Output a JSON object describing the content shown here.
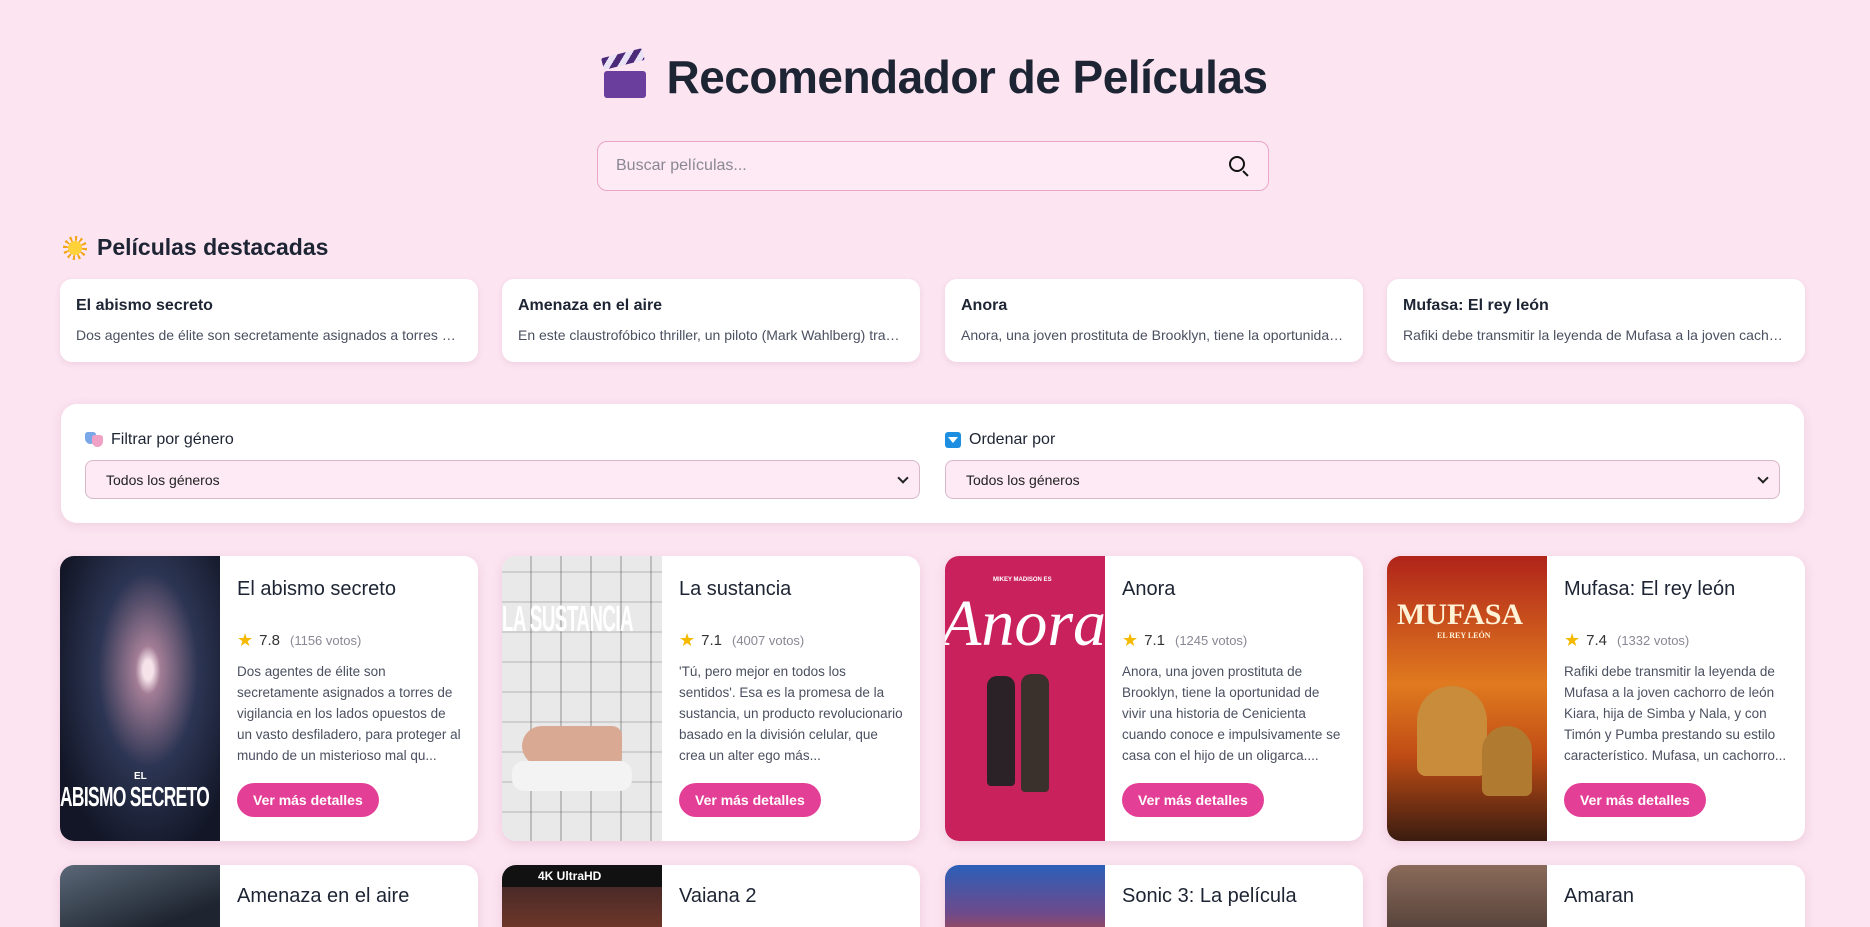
{
  "header": {
    "icon": "clapperboard-icon",
    "title": "Recomendador de Películas"
  },
  "search": {
    "placeholder": "Buscar películas...",
    "icon": "search-icon"
  },
  "featured": {
    "title": "Películas destacadas",
    "icon": "sun-icon",
    "items": [
      {
        "title": "El abismo secreto",
        "desc": "Dos agentes de élite son secretamente asignados a torres de vigilancia en los lados opuestos de un vasto desfiladero..."
      },
      {
        "title": "Amenaza en el aire",
        "desc": "En este claustrofóbico thriller, un piloto (Mark Wahlberg) transporta a una testigo..."
      },
      {
        "title": "Anora",
        "desc": "Anora, una joven prostituta de Brooklyn, tiene la oportunidad de vivir una historia de Cenicienta..."
      },
      {
        "title": "Mufasa: El rey león",
        "desc": "Rafiki debe transmitir la leyenda de Mufasa a la joven cachorro de león Kiara..."
      }
    ]
  },
  "filters": {
    "genre_label": "Filtrar por género",
    "genre_value": "Todos los géneros",
    "sort_label": "Ordenar por",
    "sort_value": "Todos los géneros"
  },
  "movies": [
    {
      "title": "El abismo secreto",
      "rating": "7.8",
      "votes": "(1156 votos)",
      "overview": "Dos agentes de élite son secretamente asignados a torres de vigilancia en los lados opuestos de un vasto desfiladero, para proteger al mundo de un misterioso mal qu...",
      "button": "Ver más detalles",
      "poster_text": "ABISMO SECRETO",
      "poster_small": "EL"
    },
    {
      "title": "La sustancia",
      "rating": "7.1",
      "votes": "(4007 votos)",
      "overview": "'Tú, pero mejor en todos los sentidos'. Esa es la promesa de la sustancia, un producto revolucionario basado en la división celular, que crea un alter ego más...",
      "button": "Ver más detalles",
      "poster_text": "LA SUSTANCIA"
    },
    {
      "title": "Anora",
      "rating": "7.1",
      "votes": "(1245 votos)",
      "overview": "Anora, una joven prostituta de Brooklyn, tiene la oportunidad de vivir una historia de Cenicienta cuando conoce e impulsivamente se casa con el hijo de un oligarca....",
      "button": "Ver más detalles",
      "poster_text": "Anora",
      "poster_small": "MIKEY MADISON ES"
    },
    {
      "title": "Mufasa: El rey león",
      "rating": "7.4",
      "votes": "(1332 votos)",
      "overview": "Rafiki debe transmitir la leyenda de Mufasa a la joven cachorro de león Kiara, hija de Simba y Nala, y con Timón y Pumba prestando su estilo característico. Mufasa, un cachorro...",
      "button": "Ver más detalles",
      "poster_text": "MUFASA",
      "poster_small": "EL REY LEÓN"
    }
  ],
  "movies_row2": [
    {
      "title": "Amenaza en el aire"
    },
    {
      "title": "Vaiana 2",
      "poster_text": "4K UltraHD"
    },
    {
      "title": "Sonic 3: La película"
    },
    {
      "title": "Amaran"
    }
  ],
  "colors": {
    "background": "#fce4f1",
    "accent": "#e43f96",
    "star": "#f5b900"
  }
}
